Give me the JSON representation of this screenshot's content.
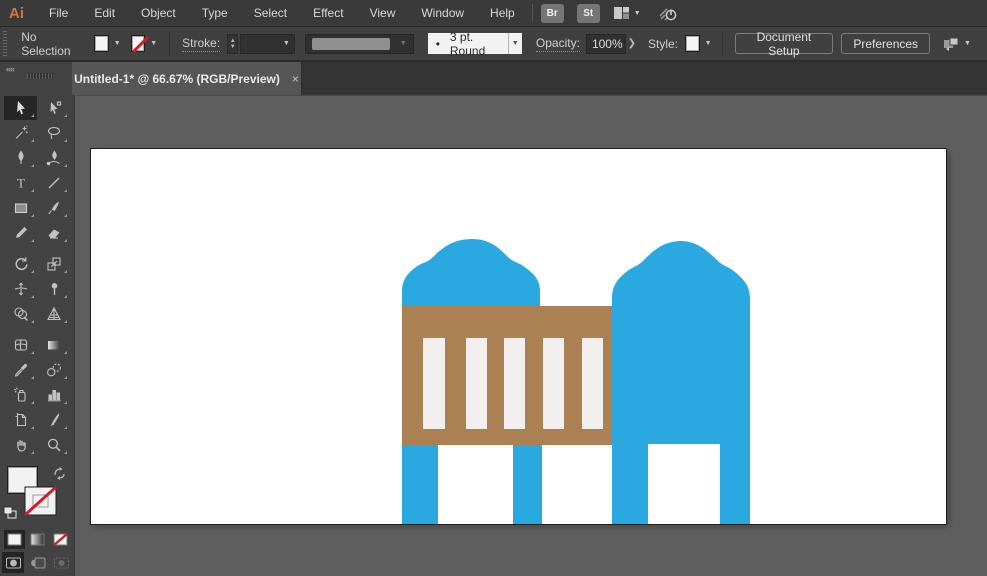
{
  "app": {
    "logo_text": "Ai"
  },
  "menubar": {
    "items": [
      "File",
      "Edit",
      "Object",
      "Type",
      "Select",
      "Effect",
      "View",
      "Window",
      "Help"
    ],
    "bridge_button": "Br",
    "stock_button": "St"
  },
  "controlbar": {
    "selection_status": "No Selection",
    "stroke_label": "Stroke:",
    "brush_bullet": "•",
    "brush_name": "3 pt. Round",
    "opacity_label": "Opacity:",
    "opacity_value": "100%",
    "style_label": "Style:",
    "document_setup_button": "Document Setup",
    "preferences_button": "Preferences"
  },
  "tabbar": {
    "collapse_icon_text": "««",
    "document_title": "Untitled-1* @ 66.67% (RGB/Preview)",
    "close_label": "×"
  },
  "toolbar": {
    "tools": [
      {
        "name": "selection",
        "active": true
      },
      {
        "name": "direct-selection",
        "active": false
      },
      {
        "name": "magic-wand",
        "active": false
      },
      {
        "name": "lasso",
        "active": false
      },
      {
        "name": "pen",
        "active": false
      },
      {
        "name": "curvature",
        "active": false
      },
      {
        "name": "type",
        "active": false
      },
      {
        "name": "line-segment",
        "active": false
      },
      {
        "name": "rectangle",
        "active": false
      },
      {
        "name": "paintbrush",
        "active": false
      },
      {
        "name": "pencil",
        "active": false
      },
      {
        "name": "eraser",
        "active": false
      },
      {
        "name": "rotate",
        "active": false
      },
      {
        "name": "scale",
        "active": false
      },
      {
        "name": "width",
        "active": false
      },
      {
        "name": "puppet-warp",
        "active": false
      },
      {
        "name": "shape-builder",
        "active": false
      },
      {
        "name": "perspective-grid",
        "active": false
      },
      {
        "name": "mesh",
        "active": false
      },
      {
        "name": "gradient",
        "active": false
      },
      {
        "name": "eyedropper",
        "active": false
      },
      {
        "name": "blend",
        "active": false
      },
      {
        "name": "symbol-sprayer",
        "active": false
      },
      {
        "name": "column-graph",
        "active": false
      },
      {
        "name": "artboard",
        "active": false
      },
      {
        "name": "slice",
        "active": false
      },
      {
        "name": "hand",
        "active": false
      },
      {
        "name": "zoom",
        "active": false
      }
    ],
    "fill_color": "#FFFFFF",
    "stroke_style": "none",
    "type_glyph": "T"
  },
  "artwork": {
    "description": "baby crib illustration on white artboard",
    "blue": "#29A9E0",
    "brown": "#AB8153",
    "slat_color": "#F2F0EE"
  },
  "colors": {
    "menubar_bg": "#3a3a3a",
    "controlbar_bg": "#404040",
    "panel_bg": "#434343",
    "pasteboard_bg": "#5E5E5E",
    "active_tab_bg": "#565656",
    "artboard_bg": "#FFFFFF",
    "none_indicator_red": "#CC1F2D",
    "logo_orange": "#D0793F"
  }
}
